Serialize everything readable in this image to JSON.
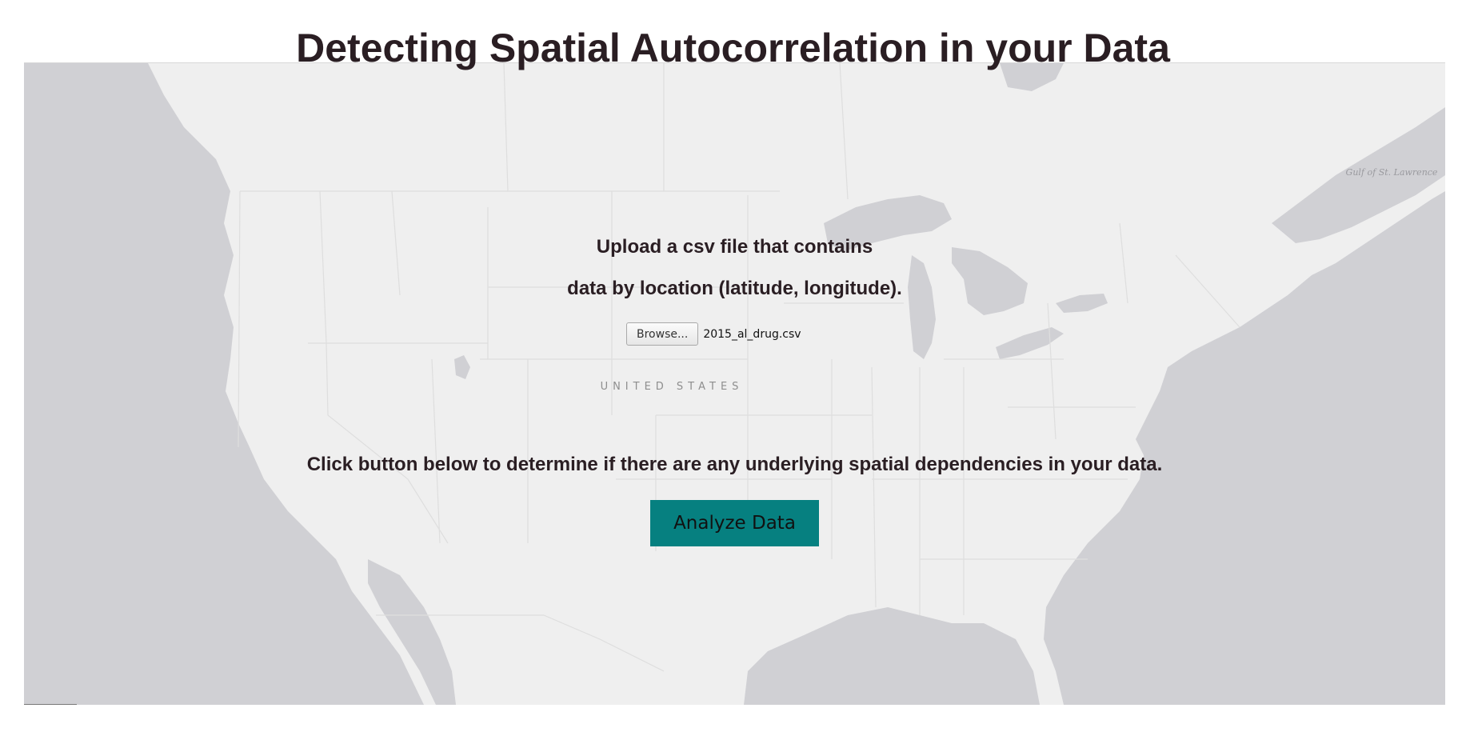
{
  "page": {
    "title": "Detecting Spatial Autocorrelation in your Data"
  },
  "map": {
    "country_label": "UNITED STATES",
    "water_label": "Gulf of St. Lawrence",
    "land_color": "#efefef",
    "water_color": "#d0d0d4"
  },
  "upload": {
    "line1": "Upload a csv file that contains",
    "line2": "data by location (latitude, longitude).",
    "browse_label": "Browse...",
    "file_name": "2015_al_drug.csv"
  },
  "analyze": {
    "instruction": "Click button below to determine if there are any underlying spatial dependencies in your data.",
    "button_label": "Analyze Data",
    "button_color": "#068080"
  }
}
